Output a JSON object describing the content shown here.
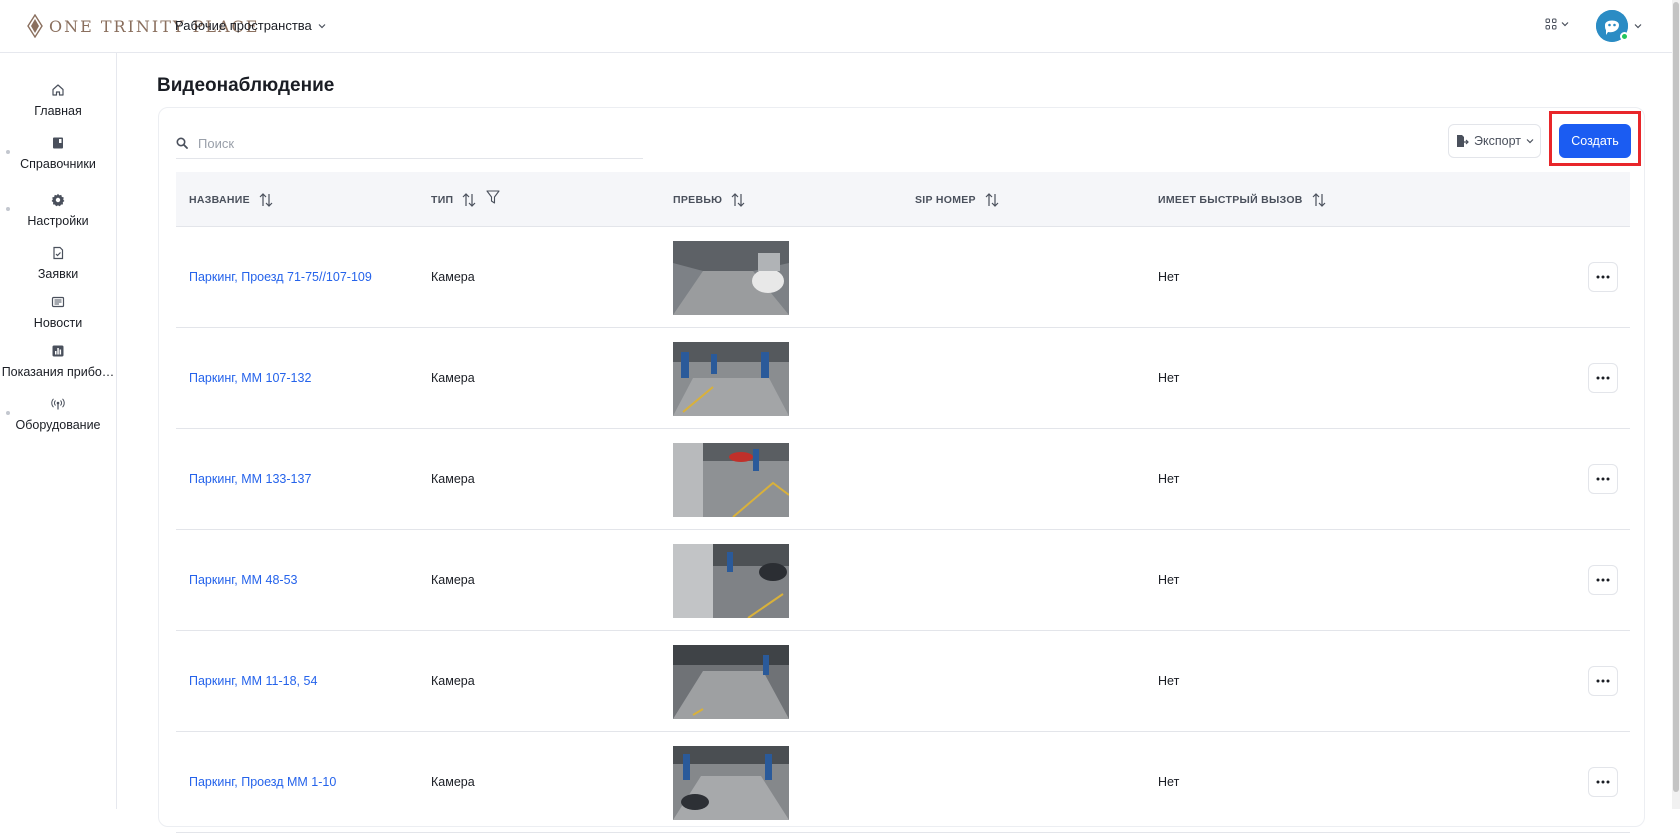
{
  "app": {
    "logo_text": "ONE TRINITY PLACE",
    "workspace_label": "Рабочие пространства"
  },
  "sidebar": {
    "items": [
      {
        "label": "Главная",
        "icon": "home-icon"
      },
      {
        "label": "Справочники",
        "icon": "book-icon"
      },
      {
        "label": "Настройки",
        "icon": "gear-icon"
      },
      {
        "label": "Заявки",
        "icon": "document-icon"
      },
      {
        "label": "Новости",
        "icon": "newspaper-icon"
      },
      {
        "label": "Показания прибо…",
        "icon": "chart-icon"
      },
      {
        "label": "Оборудование",
        "icon": "broadcast-icon"
      }
    ]
  },
  "main": {
    "title": "Видеонаблюдение",
    "search_placeholder": "Поиск",
    "export_label": "Экспорт",
    "create_label": "Создать",
    "columns": [
      "НАЗВАНИЕ",
      "ТИП",
      "ПРЕВЬЮ",
      "SIP НОМЕР",
      "ИМЕЕТ БЫСТРЫЙ ВЫЗОВ"
    ],
    "rows": [
      {
        "name": "Паркинг, Проезд 71-75//107-109",
        "type": "Камера",
        "sip": "",
        "fast_call": "Нет"
      },
      {
        "name": "Паркинг, ММ 107-132",
        "type": "Камера",
        "sip": "",
        "fast_call": "Нет"
      },
      {
        "name": "Паркинг, ММ 133-137",
        "type": "Камера",
        "sip": "",
        "fast_call": "Нет"
      },
      {
        "name": "Паркинг, ММ 48-53",
        "type": "Камера",
        "sip": "",
        "fast_call": "Нет"
      },
      {
        "name": "Паркинг, ММ 11-18, 54",
        "type": "Камера",
        "sip": "",
        "fast_call": "Нет"
      },
      {
        "name": "Паркинг, Проезд ММ 1-10",
        "type": "Камера",
        "sip": "",
        "fast_call": "Нет"
      }
    ]
  },
  "colors": {
    "accent": "#1b5cf2",
    "link": "#2563eb",
    "highlight": "#e8262a"
  }
}
